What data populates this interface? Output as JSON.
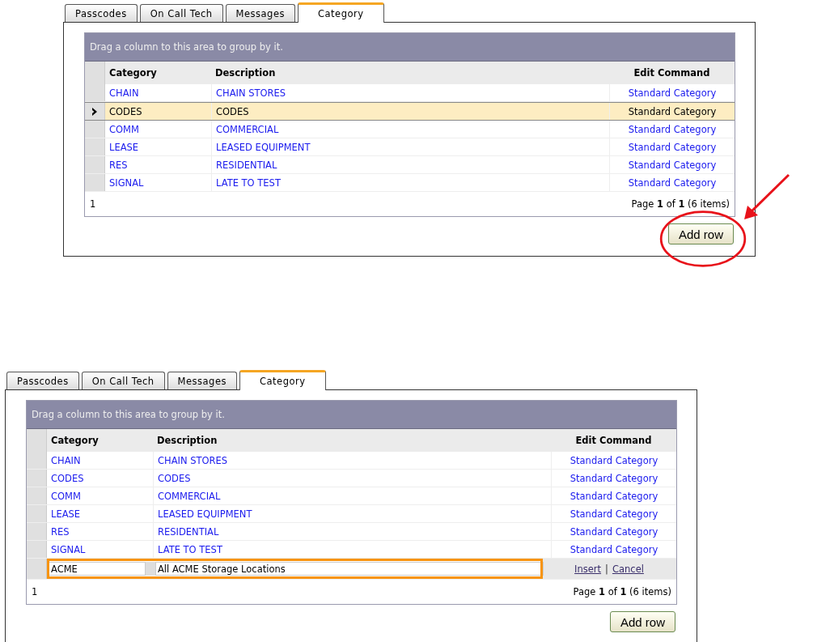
{
  "panels": [
    {
      "tabs": [
        {
          "label": "Passcodes",
          "selected": false
        },
        {
          "label": "On Call Tech",
          "selected": false
        },
        {
          "label": "Messages",
          "selected": false
        },
        {
          "label": "Category",
          "selected": true
        }
      ],
      "group_hint": "Drag a column to this area to group by it.",
      "columns": [
        "Category",
        "Description",
        "Edit Command"
      ],
      "rows": [
        {
          "category": "CHAIN",
          "description": "CHAIN STORES",
          "edit_command": "Standard Category",
          "selected": false
        },
        {
          "category": "CODES",
          "description": "CODES",
          "edit_command": "Standard Category",
          "selected": true
        },
        {
          "category": "COMM",
          "description": "COMMERCIAL",
          "edit_command": "Standard Category",
          "selected": false
        },
        {
          "category": "LEASE",
          "description": "LEASED EQUIPMENT",
          "edit_command": "Standard Category",
          "selected": false
        },
        {
          "category": "RES",
          "description": "RESIDENTIAL",
          "edit_command": "Standard Category",
          "selected": false
        },
        {
          "category": "SIGNAL",
          "description": "LATE TO TEST",
          "edit_command": "Standard Category",
          "selected": false
        }
      ],
      "pager": {
        "page_number": "1",
        "summary": "Page **1** of **1** (6 items)"
      },
      "add_button": {
        "label": "Add row",
        "highlighted": true
      }
    },
    {
      "tabs": [
        {
          "label": "Passcodes",
          "selected": false
        },
        {
          "label": "On Call Tech",
          "selected": false
        },
        {
          "label": "Messages",
          "selected": false
        },
        {
          "label": "Category",
          "selected": true
        }
      ],
      "group_hint": "Drag a column to this area to group by it.",
      "columns": [
        "Category",
        "Description",
        "Edit Command"
      ],
      "rows": [
        {
          "category": "CHAIN",
          "description": "CHAIN STORES",
          "edit_command": "Standard Category",
          "selected": false
        },
        {
          "category": "CODES",
          "description": "CODES",
          "edit_command": "Standard Category",
          "selected": false
        },
        {
          "category": "COMM",
          "description": "COMMERCIAL",
          "edit_command": "Standard Category",
          "selected": false
        },
        {
          "category": "LEASE",
          "description": "LEASED EQUIPMENT",
          "edit_command": "Standard Category",
          "selected": false
        },
        {
          "category": "RES",
          "description": "RESIDENTIAL",
          "edit_command": "Standard Category",
          "selected": false
        },
        {
          "category": "SIGNAL",
          "description": "LATE TO TEST",
          "edit_command": "Standard Category",
          "selected": false
        }
      ],
      "new_row": {
        "category": "ACME",
        "description": "All ACME Storage Locations",
        "actions": [
          "Insert",
          "Cancel"
        ],
        "separator": "|"
      },
      "pager": {
        "page_number": "1",
        "summary": "Page **1** of **1** (6 items)"
      },
      "add_button": {
        "label": "Add row",
        "highlighted": false
      }
    }
  ]
}
